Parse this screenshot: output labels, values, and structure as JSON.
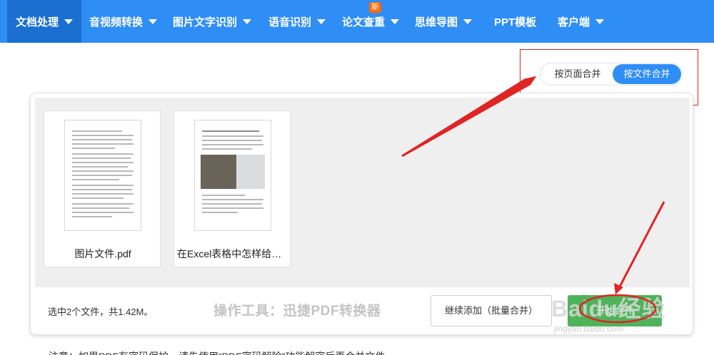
{
  "nav": {
    "items": [
      {
        "label": "文档处理",
        "active": true
      },
      {
        "label": "音视频转换"
      },
      {
        "label": "图片文字识别"
      },
      {
        "label": "语音识别"
      },
      {
        "label": "论文查重",
        "badge": "新"
      },
      {
        "label": "思维导图"
      },
      {
        "label": "PPT模板"
      },
      {
        "label": "客户端"
      }
    ]
  },
  "merge_mode": {
    "by_page": "按页面合并",
    "by_file": "按文件合并",
    "selected": "by_file"
  },
  "files": [
    {
      "name": "图片文件.pdf"
    },
    {
      "name": "在Excel表格中怎样给数..."
    }
  ],
  "footer": {
    "summary": "选中2个文件，共1.42M。",
    "tool_label": "操作工具：迅捷PDF转换器",
    "add_button": "继续添加（批量合并）",
    "merge_button": "开始合并"
  },
  "watermark": {
    "logo": "Baidu经验",
    "url": "jingyan.baidu.com"
  },
  "bottom_text": "注意：如果PDF有密码保护，请先使用“PDF密码解除”功能解密后再合并文件",
  "colors": {
    "nav_bg": "#2f8ef5",
    "nav_active": "#1a6fd1",
    "accent": "#2f8ef5",
    "merge_green": "#4eb35a",
    "annotation_red": "#e02424",
    "badge": "#ff6a00"
  }
}
